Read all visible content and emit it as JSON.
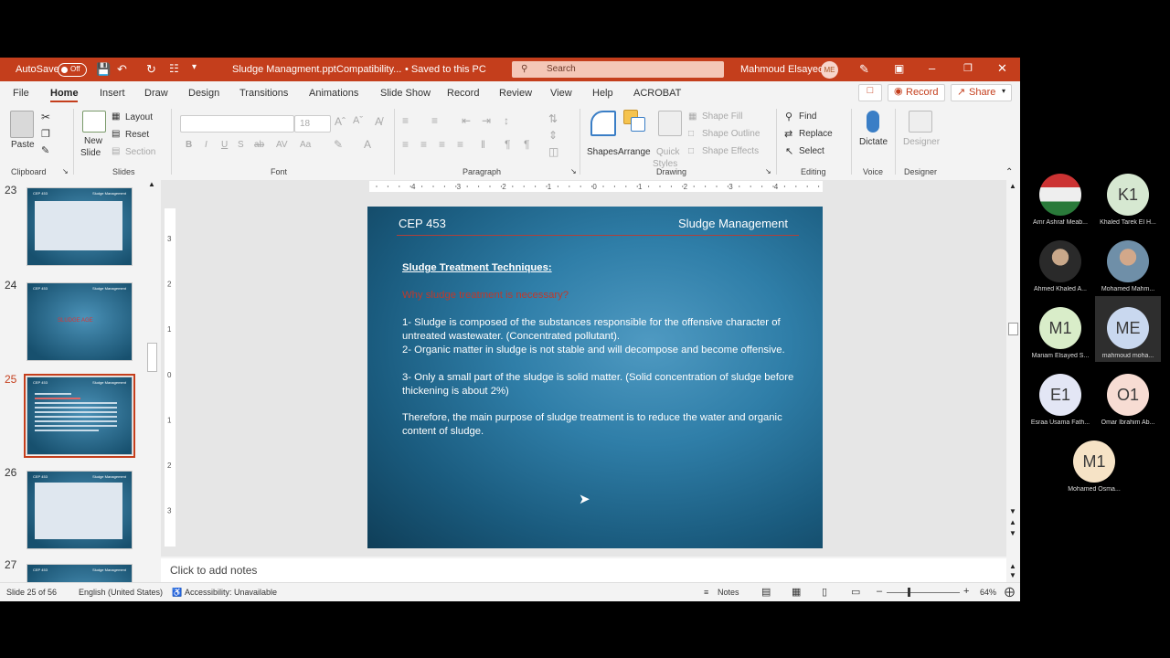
{
  "titlebar": {
    "autosave_label": "AutoSave",
    "autosave_state": "Off",
    "doc_title": "Sludge Managment.ppt",
    "compat": "Compatibility...",
    "saved": "• Saved to this PC",
    "search_placeholder": "Search",
    "user_name": "Mahmoud Elsayed",
    "user_initials": "ME"
  },
  "menu": {
    "tabs": [
      "File",
      "Home",
      "Insert",
      "Draw",
      "Design",
      "Transitions",
      "Animations",
      "Slide Show",
      "Record",
      "Review",
      "View",
      "Help",
      "ACROBAT"
    ],
    "record_button": "Record",
    "share_button": "Share"
  },
  "ribbon": {
    "clipboard": {
      "paste": "Paste",
      "label": "Clipboard"
    },
    "slides": {
      "new_slide": "New",
      "new_slide2": "Slide",
      "layout": "Layout",
      "reset": "Reset",
      "section": "Section",
      "label": "Slides"
    },
    "font": {
      "size": "18",
      "label": "Font"
    },
    "paragraph": {
      "label": "Paragraph"
    },
    "drawing": {
      "shapes": "Shapes",
      "arrange": "Arrange",
      "quick_styles": "Quick",
      "quick_styles2": "Styles",
      "shape_fill": "Shape Fill",
      "shape_outline": "Shape Outline",
      "shape_effects": "Shape Effects",
      "label": "Drawing"
    },
    "editing": {
      "find": "Find",
      "replace": "Replace",
      "select": "Select",
      "label": "Editing"
    },
    "voice": {
      "dictate": "Dictate",
      "label": "Voice"
    },
    "designer": {
      "designer": "Designer",
      "label": "Designer"
    }
  },
  "thumbnails": [
    {
      "num": "23",
      "selected": false,
      "text": ""
    },
    {
      "num": "24",
      "selected": false,
      "text": "SLUDGE AGE"
    },
    {
      "num": "25",
      "selected": true,
      "text": ""
    },
    {
      "num": "26",
      "selected": false,
      "text": ""
    },
    {
      "num": "27",
      "selected": false,
      "text": ""
    }
  ],
  "slide": {
    "header_left": "CEP 453",
    "header_right": "Sludge Management",
    "heading": "Sludge Treatment Techniques:",
    "question": "Why sludge treatment is necessary?",
    "point1": "1- Sludge is composed of the substances responsible for the offensive character of untreated wastewater. (Concentrated pollutant).",
    "point2": "2- Organic matter in sludge is not stable and will decompose and become offensive.",
    "point3": "3- Only a small part of the sludge is solid matter. (Solid concentration of sludge before thickening is about 2%)",
    "conclusion": "Therefore, the main purpose of sludge treatment is to reduce the water and organic content of sludge.",
    "accent_color": "#c0392b"
  },
  "ruler": {
    "h_ticks": [
      "4",
      "3",
      "2",
      "1",
      "0",
      "1",
      "2",
      "3",
      "4"
    ],
    "v_ticks": [
      "3",
      "2",
      "1",
      "0",
      "1",
      "2",
      "3"
    ]
  },
  "notes_placeholder": "Click to add notes",
  "status": {
    "slide_counter": "Slide 25 of 56",
    "language": "English (United States)",
    "accessibility": "Accessibility: Unavailable",
    "notes": "Notes",
    "zoom": "64%"
  },
  "participants": [
    {
      "initials": "",
      "name": "Amr Ashraf Meab...",
      "color": "#8a2a2a"
    },
    {
      "initials": "K1",
      "name": "Khaled Tarek El H...",
      "color": "#d6e8d1"
    },
    {
      "initials": "",
      "name": "Ahmed Khaled A...",
      "color": "#6d7a80"
    },
    {
      "initials": "",
      "name": "Mohamed Mahm...",
      "color": "#8a8f7a"
    },
    {
      "initials": "M1",
      "name": "Mariam Elsayed S...",
      "color": "#d9edc9"
    },
    {
      "initials": "ME",
      "name": "mahmoud moha...",
      "color": "#c9d8ef"
    },
    {
      "initials": "E1",
      "name": "Esraa Usama Fath...",
      "color": "#e3e6f5"
    },
    {
      "initials": "O1",
      "name": "Omar Ibrahim Ab...",
      "color": "#f7dcd3"
    },
    {
      "initials": "M1",
      "name": "Mohamed Osma...",
      "color": "#f6e3c6"
    }
  ]
}
